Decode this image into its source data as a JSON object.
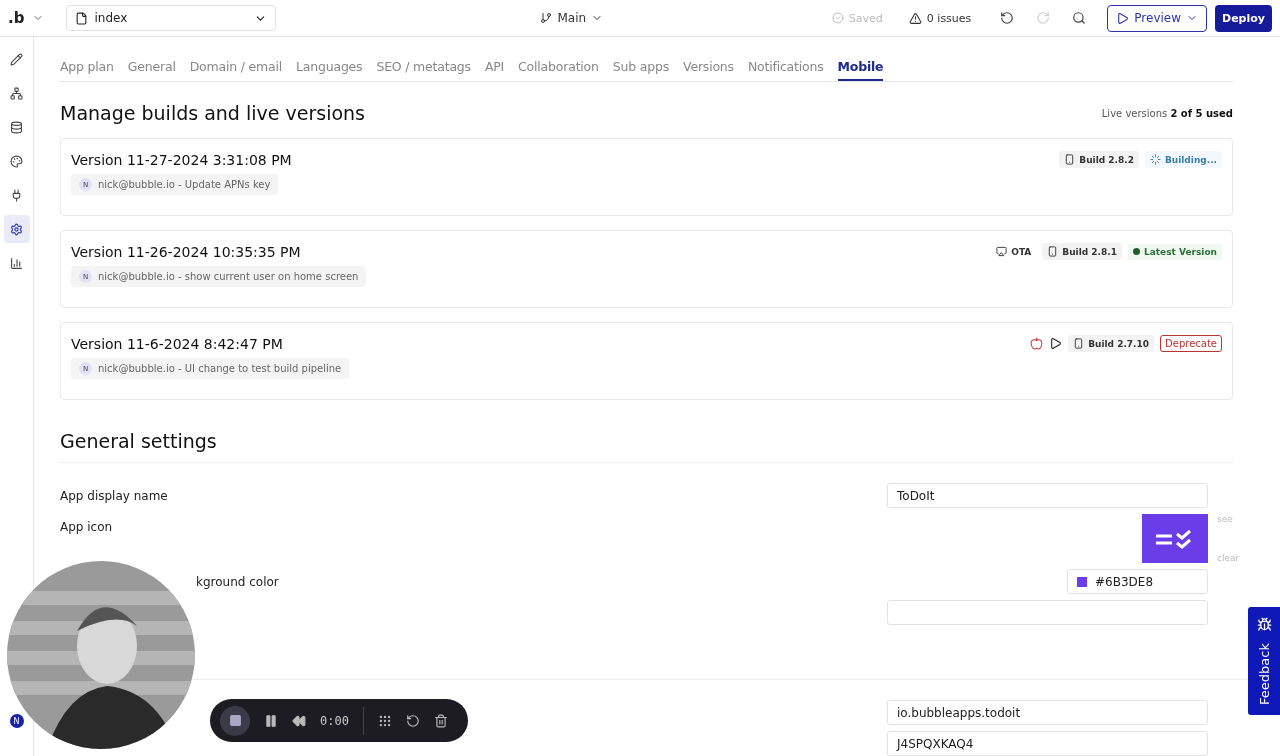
{
  "topbar": {
    "logo": ".b",
    "page_select": "index",
    "branch": "Main",
    "save_status": "Saved",
    "issues": "0 issues",
    "redo_disabled": true,
    "preview_button": "Preview",
    "deploy_button": "Deploy"
  },
  "sidebar": {
    "items": [
      {
        "selected": false
      },
      {
        "selected": false
      },
      {
        "selected": false
      },
      {
        "selected": false
      },
      {
        "selected": false
      },
      {
        "selected": true
      },
      {
        "selected": false
      }
    ],
    "avatar": "N"
  },
  "tabs": [
    {
      "label": "App plan",
      "selected": false
    },
    {
      "label": "General",
      "selected": false
    },
    {
      "label": "Domain / email",
      "selected": false
    },
    {
      "label": "Languages",
      "selected": false
    },
    {
      "label": "SEO / metatags",
      "selected": false
    },
    {
      "label": "API",
      "selected": false
    },
    {
      "label": "Collaboration",
      "selected": false
    },
    {
      "label": "Sub apps",
      "selected": false
    },
    {
      "label": "Versions",
      "selected": false
    },
    {
      "label": "Notifications",
      "selected": false
    },
    {
      "label": "Mobile",
      "selected": true
    }
  ],
  "builds": {
    "title": "Manage builds and live versions",
    "live_versions": "Live versions **2 of 5 used**",
    "versions": [
      {
        "title": "Version 11-27-2024 3:31:08 PM",
        "author_initial": "N",
        "note": "nick@bubble.io - Update APNs key",
        "badges": [
          {
            "kind": "build",
            "label": "Build 2.8.2"
          },
          {
            "kind": "building",
            "label": "Building..."
          }
        ]
      },
      {
        "title": "Version 11-26-2024 10:35:35 PM",
        "author_initial": "N",
        "note": "nick@bubble.io - show current user on home screen",
        "badges": [
          {
            "kind": "ota",
            "label": "OTA"
          },
          {
            "kind": "build",
            "label": "Build 2.8.1"
          },
          {
            "kind": "latest",
            "label": "Latest Version"
          }
        ]
      },
      {
        "title": "Version 11-6-2024 8:42:47 PM",
        "author_initial": "N",
        "note": "nick@bubble.io - UI change to test build pipeline",
        "badges": [
          {
            "kind": "apple"
          },
          {
            "kind": "play"
          },
          {
            "kind": "build",
            "label": "Build 2.7.10"
          },
          {
            "kind": "deprecate",
            "label": "Deprecate"
          }
        ]
      }
    ]
  },
  "general_settings": {
    "title": "General settings",
    "rows": [
      {
        "kind": "text",
        "label": "App display name",
        "value": "ToDoIt"
      },
      {
        "kind": "icon",
        "label": "App icon",
        "links": [
          "see",
          "clear"
        ]
      },
      {
        "kind": "color",
        "label": "kground color",
        "value": "#6B3DE8",
        "color": "#6b3de8"
      },
      {
        "kind": "text"
      }
    ],
    "rows_after_divider": [
      {
        "kind": "text",
        "value": "io.bubbleapps.todoit"
      },
      {
        "kind": "text",
        "value": "J4SPQXKAQ4"
      }
    ]
  },
  "recorder": {
    "time": "0:00"
  },
  "feedback_tab": "Feedback"
}
